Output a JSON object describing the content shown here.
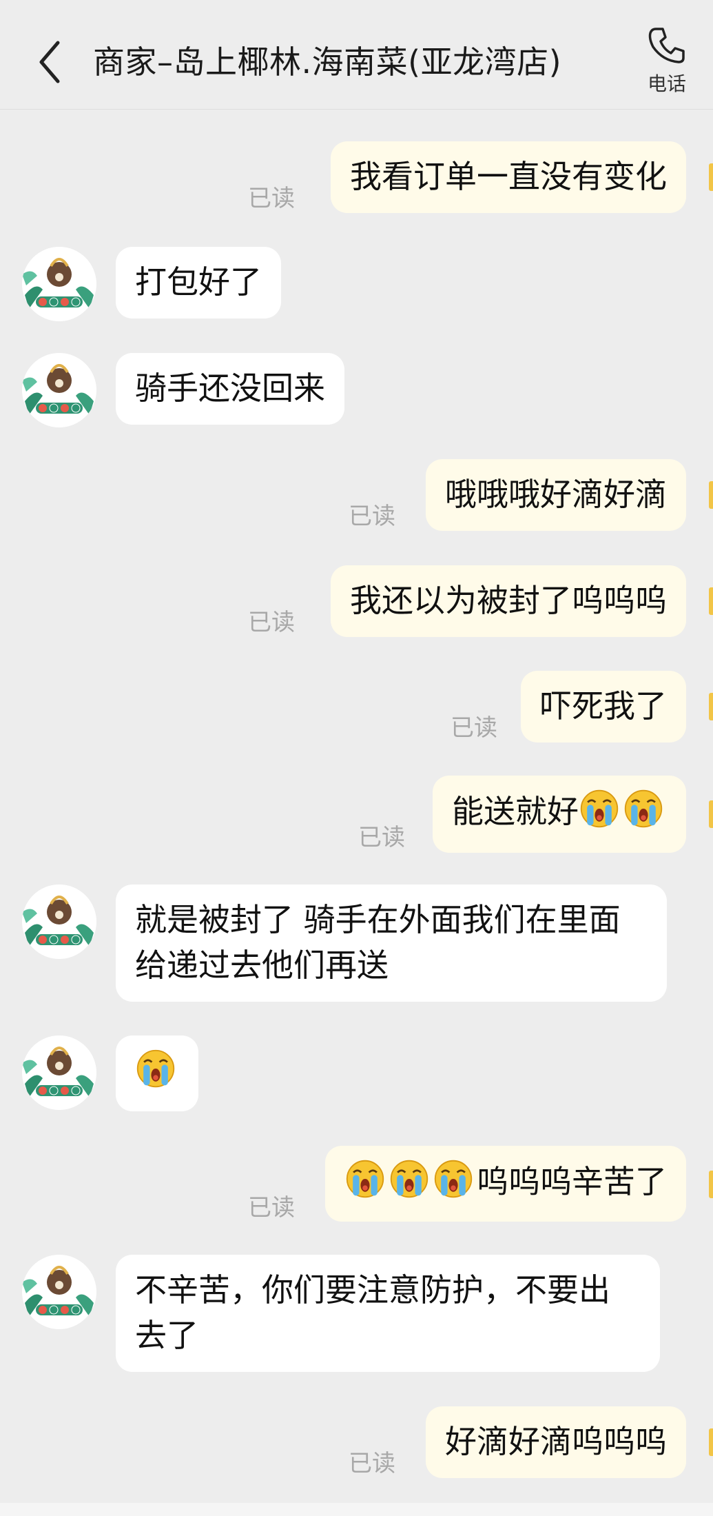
{
  "header": {
    "title": "商家–岛上椰林.海南菜(亚龙湾店)",
    "phone_label": "电话"
  },
  "avatar": {
    "name_line": "岛上椰林",
    "sub_line": "DAOSHANGYELIN",
    "tag_line": "椰子鸡海南菜"
  },
  "read_label": "已读",
  "messages": [
    {
      "dir": "out",
      "text": "我看订单一直没有变化",
      "status": "已读"
    },
    {
      "dir": "in",
      "text": "打包好了"
    },
    {
      "dir": "in",
      "text": "骑手还没回来"
    },
    {
      "dir": "out",
      "text": "哦哦哦好滴好滴",
      "status": "已读"
    },
    {
      "dir": "out",
      "text": "我还以为被封了呜呜呜",
      "status": "已读"
    },
    {
      "dir": "out",
      "text": "吓死我了",
      "status": "已读"
    },
    {
      "dir": "out",
      "text": "能送就好",
      "emoji": [
        "crying-face",
        "crying-face"
      ],
      "status": "已读"
    },
    {
      "dir": "in",
      "text": "就是被封了 骑手在外面我们在里面给递过去他们再送"
    },
    {
      "dir": "in",
      "text": "",
      "emoji": [
        "crying-face"
      ]
    },
    {
      "dir": "out",
      "text": "呜呜呜辛苦了",
      "emoji_before": [
        "crying-face",
        "crying-face",
        "crying-face"
      ],
      "status": "已读"
    },
    {
      "dir": "in",
      "text": "不辛苦，你们要注意防护，不要出去了"
    },
    {
      "dir": "out",
      "text": "好滴好滴呜呜呜",
      "status": "已读"
    }
  ],
  "colors": {
    "background": "#ededed",
    "incoming_bubble": "#ffffff",
    "outgoing_bubble": "#fffbe9",
    "read_text": "#a8a8a8"
  }
}
